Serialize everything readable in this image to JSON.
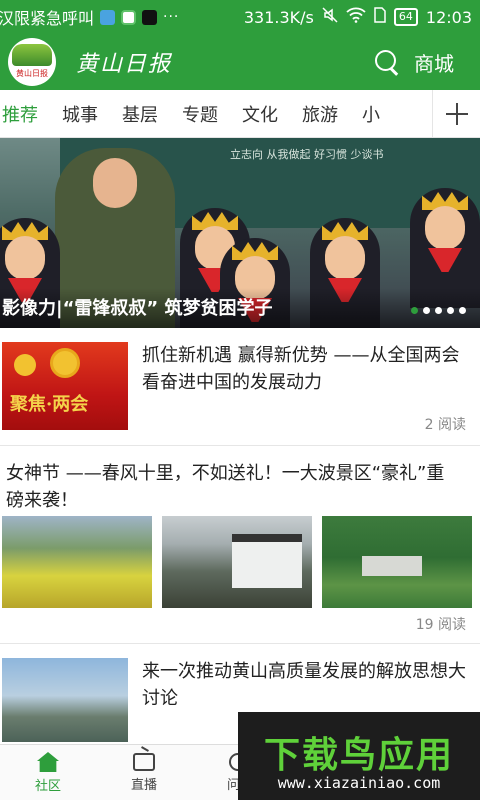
{
  "status_bar": {
    "notification_text": "汉限紧急呼叫",
    "network_speed": "331.3K/s",
    "battery": "64",
    "time": "12:03",
    "dots": "···"
  },
  "header": {
    "brand": "黄山日报",
    "logo_text": "黄山日报",
    "shop_label": "商城"
  },
  "tabs": [
    "推荐",
    "城事",
    "基层",
    "专题",
    "文化",
    "旅游",
    "小"
  ],
  "active_tab": "推荐",
  "banner": {
    "caption": "影像力|“雷锋叔叔” 筑梦贫困学子",
    "board_text": "立志向 从我做起  好习惯 少谈书",
    "slide_count": 5,
    "active_slide": 1
  },
  "articles": [
    {
      "title": "抓住新机遇 赢得新优势 ——从全国两会看奋进中国的发展动力",
      "thumb_text": "聚焦·两会",
      "reads": "2 阅读"
    },
    {
      "title": "女神节 ——春风十里，不如送礼！一大波景区“豪礼”重磅来袭！",
      "reads": "19 阅读"
    },
    {
      "title": "来一次推动黄山高质量发展的解放思想大讨论"
    }
  ],
  "bottom_nav": [
    {
      "label": "社区",
      "icon": "home-icon",
      "active": true
    },
    {
      "label": "直播",
      "icon": "tv-icon",
      "active": false
    },
    {
      "label": "问政",
      "icon": "chat-icon",
      "active": false
    }
  ],
  "watermark": {
    "title": "下载鸟应用",
    "url": "www.xiazainiao.com"
  },
  "colors": {
    "brand_green": "#2e9e3c",
    "watermark_green": "#5fd13a"
  }
}
